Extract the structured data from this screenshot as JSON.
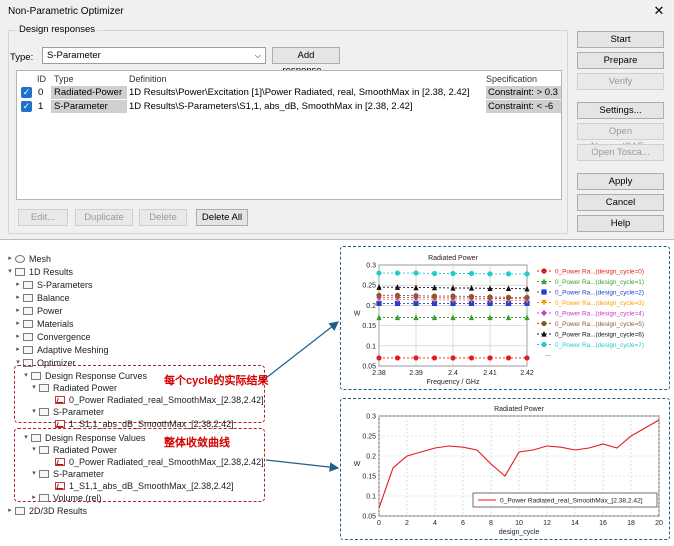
{
  "dialog": {
    "title": "Non-Parametric Optimizer",
    "close_glyph": "✕",
    "group_label": "Design responses",
    "type_label": "Type:",
    "type_value": "S-Parameter",
    "add_response": "Add response...",
    "columns": {
      "id": "ID",
      "type": "Type",
      "definition": "Definition",
      "specification": "Specification"
    },
    "rows": [
      {
        "checked": true,
        "id": "0",
        "type": "Radiated-Power",
        "definition": "1D Results\\Power\\Excitation [1]\\Power Radiated, real, SmoothMax in [2.38, 2.42]",
        "specification": "Constraint: > 0.3"
      },
      {
        "checked": true,
        "id": "1",
        "type": "S-Parameter",
        "definition": "1D Results\\S-Parameters\\S1,1, abs_dB, SmoothMax in [2.38, 2.42]",
        "specification": "Constraint: < -6"
      }
    ],
    "bottom_buttons": {
      "edit": "Edit...",
      "duplicate": "Duplicate",
      "delete": "Delete",
      "delete_all": "Delete All"
    },
    "right_buttons": {
      "start": "Start",
      "prepare": "Prepare",
      "verify": "Verify",
      "settings": "Settings...",
      "open_abaqus": "Open Abaqus/CAE...",
      "open_tosca": "Open Tosca...",
      "apply": "Apply",
      "cancel": "Cancel",
      "help": "Help"
    }
  },
  "tree": {
    "mesh": "Mesh",
    "results_1d": "1D Results",
    "s_parameters": "S-Parameters",
    "balance": "Balance",
    "power": "Power",
    "materials": "Materials",
    "convergence": "Convergence",
    "adaptive_meshing": "Adaptive Meshing",
    "optimizer": "Optimizer",
    "drc": "Design Response Curves",
    "drc_radiated_power": "Radiated Power",
    "drc_rp_item": "0_Power Radiated_real_SmoothMax_[2.38,2.42]",
    "drc_s_parameter": "S-Parameter",
    "drc_sp_item": "1_S1,1_abs_dB_SmoothMax_[2.38,2.42]",
    "drv": "Design Response Values",
    "drv_radiated_power": "Radiated Power",
    "drv_rp_item": "0_Power Radiated_real_SmoothMax_[2.38,2.42]",
    "drv_s_parameter": "S-Parameter",
    "drv_sp_item": "1_S1,1_abs_dB_SmoothMax_[2.38,2.42]",
    "volume": "Volume (rel)",
    "results_2d3d": "2D/3D Results"
  },
  "annotations": {
    "per_cycle": "每个cycle的实际结果",
    "convergence": "整体收敛曲线"
  },
  "chart_data": [
    {
      "type": "line",
      "title": "Radiated Power",
      "xlabel": "Frequency / GHz",
      "ylabel": "W",
      "xlim": [
        2.38,
        2.42
      ],
      "ylim": [
        0.05,
        0.3
      ],
      "xticks": [
        "2.38",
        "2.39",
        "2.4",
        "2.41",
        "2.42"
      ],
      "yticks": [
        "0.05",
        "0.1",
        "0.15",
        "0.2",
        "0.25",
        "0.3"
      ],
      "grid": true,
      "legend": "right",
      "legend_more": "...",
      "x": [
        2.38,
        2.385,
        2.39,
        2.395,
        2.4,
        2.405,
        2.41,
        2.415,
        2.42
      ],
      "series": [
        {
          "name": "0_Power Ra...(design_cycle=0)",
          "color": "#e41a1c",
          "marker": "circle",
          "values": [
            0.07,
            0.07,
            0.07,
            0.07,
            0.07,
            0.07,
            0.07,
            0.07,
            0.07
          ]
        },
        {
          "name": "0_Power Ra...(design_cycle=1)",
          "color": "#33a02c",
          "marker": "triangle",
          "values": [
            0.17,
            0.17,
            0.17,
            0.17,
            0.17,
            0.17,
            0.17,
            0.17,
            0.17
          ]
        },
        {
          "name": "0_Power Ra...(design_cycle=2)",
          "color": "#1f3fd6",
          "marker": "square",
          "values": [
            0.205,
            0.205,
            0.205,
            0.205,
            0.205,
            0.205,
            0.205,
            0.205,
            0.205
          ]
        },
        {
          "name": "0_Power Ra...(design_cycle=3)",
          "color": "#ff9900",
          "marker": "triangle-down",
          "values": [
            0.215,
            0.215,
            0.214,
            0.214,
            0.213,
            0.213,
            0.213,
            0.212,
            0.212
          ]
        },
        {
          "name": "0_Power Ra...(design_cycle=4)",
          "color": "#cc33cc",
          "marker": "diamond",
          "values": [
            0.22,
            0.22,
            0.219,
            0.219,
            0.218,
            0.218,
            0.217,
            0.217,
            0.216
          ]
        },
        {
          "name": "0_Power Ra...(design_cycle=5)",
          "color": "#8b5a2b",
          "marker": "circle",
          "values": [
            0.225,
            0.225,
            0.224,
            0.223,
            0.223,
            0.222,
            0.221,
            0.22,
            0.22
          ]
        },
        {
          "name": "0_Power Ra...(design_cycle=6)",
          "color": "#111111",
          "marker": "triangle",
          "values": [
            0.245,
            0.245,
            0.244,
            0.244,
            0.243,
            0.243,
            0.242,
            0.242,
            0.241
          ]
        },
        {
          "name": "0_Power Ra...(design_cycle=7)",
          "color": "#22cccc",
          "marker": "circle",
          "values": [
            0.28,
            0.28,
            0.28,
            0.279,
            0.279,
            0.279,
            0.278,
            0.278,
            0.278
          ]
        }
      ]
    },
    {
      "type": "line",
      "title": "Radiated Power",
      "xlabel": "design_cycle",
      "ylabel": "W",
      "xlim": [
        0,
        20
      ],
      "ylim": [
        0.05,
        0.3
      ],
      "xticks": [
        "0",
        "2",
        "4",
        "6",
        "8",
        "10",
        "12",
        "14",
        "16",
        "18",
        "20"
      ],
      "yticks": [
        "0.05",
        "0.1",
        "0.15",
        "0.2",
        "0.25",
        "0.3"
      ],
      "grid": true,
      "legend": "bottom-right",
      "x": [
        0,
        1,
        2,
        3,
        4,
        5,
        6,
        7,
        8,
        9,
        10,
        11,
        12,
        13,
        14,
        15,
        16,
        17,
        18,
        19,
        20
      ],
      "series": [
        {
          "name": "0_Power Radiated_real_SmoothMax_[2.38,2.42]",
          "color": "#e41a1c",
          "values": [
            0.07,
            0.17,
            0.2,
            0.21,
            0.22,
            0.225,
            0.222,
            0.215,
            0.18,
            0.15,
            0.21,
            0.215,
            0.225,
            0.222,
            0.215,
            0.22,
            0.23,
            0.22,
            0.25,
            0.27,
            0.29
          ]
        }
      ]
    }
  ]
}
